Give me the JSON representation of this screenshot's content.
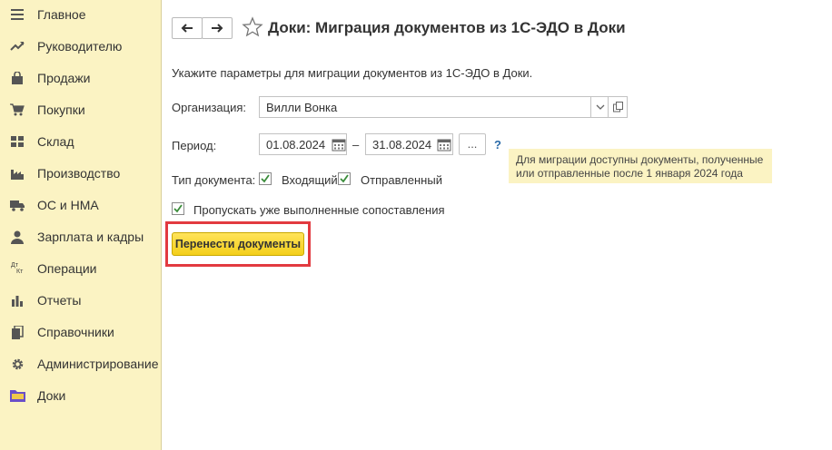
{
  "sidebar": {
    "items": [
      {
        "label": "Главное",
        "icon": "hamburger-icon"
      },
      {
        "label": "Руководителю",
        "icon": "trend-icon"
      },
      {
        "label": "Продажи",
        "icon": "shopping-bag-icon"
      },
      {
        "label": "Покупки",
        "icon": "cart-icon"
      },
      {
        "label": "Склад",
        "icon": "warehouse-icon"
      },
      {
        "label": "Производство",
        "icon": "factory-icon"
      },
      {
        "label": "ОС и НМА",
        "icon": "truck-icon"
      },
      {
        "label": "Зарплата и кадры",
        "icon": "person-icon"
      },
      {
        "label": "Операции",
        "icon": "debit-credit-icon"
      },
      {
        "label": "Отчеты",
        "icon": "bar-chart-icon"
      },
      {
        "label": "Справочники",
        "icon": "books-icon"
      },
      {
        "label": "Администрирование",
        "icon": "gear-icon"
      },
      {
        "label": "Доки",
        "icon": "folder-icon"
      }
    ],
    "operations_icon_text": {
      "top": "Дт",
      "bottom": "Кт"
    }
  },
  "header": {
    "title": "Доки: Миграция документов из 1С-ЭДО в Доки"
  },
  "form": {
    "hint": "Укажите параметры для миграции документов из 1С-ЭДО в Доки.",
    "organization_label": "Организация:",
    "organization_value": "Вилли Вонка",
    "period_label": "Период:",
    "date_from": "01.08.2024",
    "date_separator": "–",
    "date_to": "31.08.2024",
    "period_more": "...",
    "help": "?",
    "doc_type_label": "Тип документа:",
    "incoming_label": "Входящий",
    "incoming_checked": true,
    "sent_label": "Отправленный",
    "sent_checked": true,
    "skip_label": "Пропускать уже выполненные сопоставления",
    "skip_checked": true,
    "tooltip": "Для миграции доступны документы, полученные или отправленные после 1 января 2024 года",
    "submit_label": "Перенести документы"
  },
  "colors": {
    "sidebar_bg": "#fbf3c3",
    "primary_button": "#f4cf1a",
    "check_green": "#3a8c3a",
    "highlight": "#e23a40",
    "help_blue": "#2a6aa8"
  }
}
